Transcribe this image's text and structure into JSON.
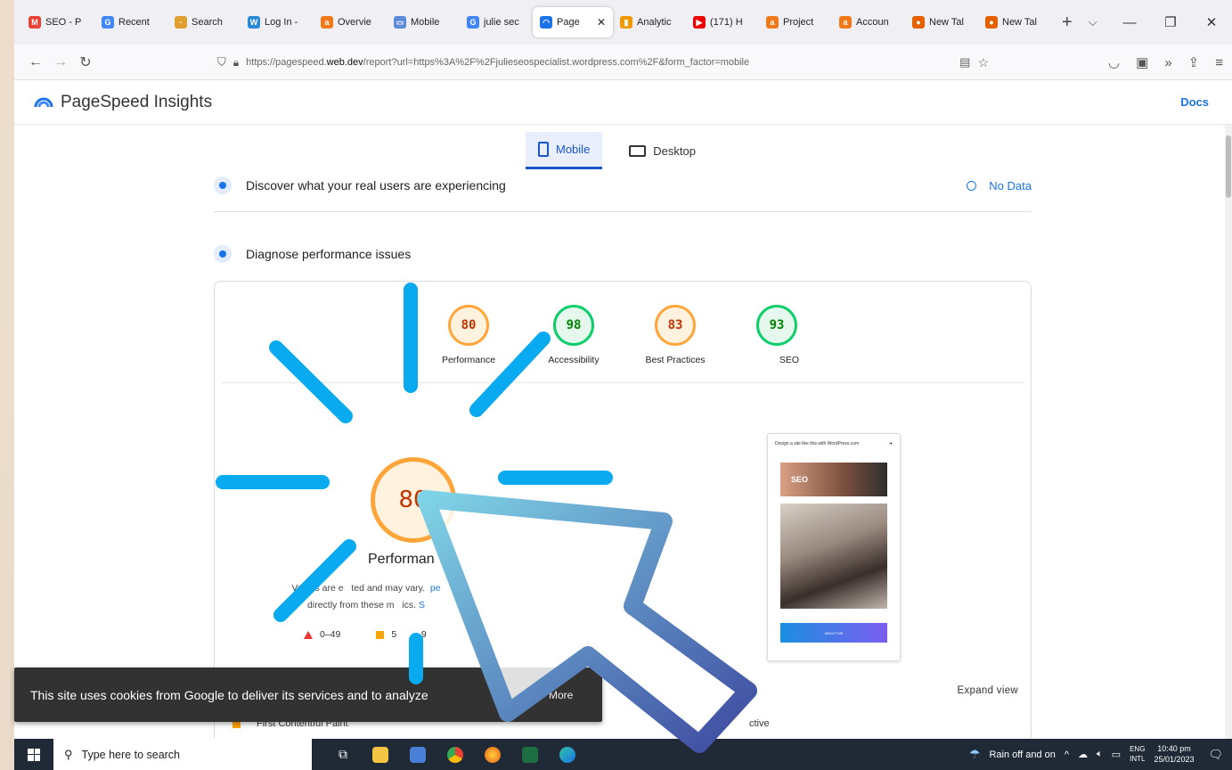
{
  "tabs": [
    {
      "label": "SEO - P",
      "color": "#ea4335",
      "glyph": "M"
    },
    {
      "label": "Recent",
      "color": "#4285f4",
      "glyph": "G"
    },
    {
      "label": "Search",
      "color": "#e0a030",
      "glyph": "·"
    },
    {
      "label": "Log In -",
      "color": "#2a8ad8",
      "glyph": "W"
    },
    {
      "label": "Overvie",
      "color": "#f07a1a",
      "glyph": "a"
    },
    {
      "label": "Mobile",
      "color": "#5a8ad8",
      "glyph": "▭"
    },
    {
      "label": "julie sec",
      "color": "#4285f4",
      "glyph": "G"
    },
    {
      "label": "Page",
      "color": "#1a73e8",
      "glyph": "◠",
      "active": true
    },
    {
      "label": "Analytic",
      "color": "#f29900",
      "glyph": "▮"
    },
    {
      "label": "(171) H",
      "color": "#e00",
      "glyph": "▶"
    },
    {
      "label": "Project",
      "color": "#f07a1a",
      "glyph": "a"
    },
    {
      "label": "Accoun",
      "color": "#f07a1a",
      "glyph": "a"
    },
    {
      "label": "New Tal",
      "color": "#e66000",
      "glyph": "●"
    },
    {
      "label": "New Tal",
      "color": "#e66000",
      "glyph": "●"
    }
  ],
  "browser": {
    "url_prefix": "https://pagespeed.",
    "url_host": "web.dev",
    "url_rest": "/report?url=https%3A%2F%2Fjulieseospecialist.wordpress.com%2F&form_factor=mobile"
  },
  "psi": {
    "title": "PageSpeed Insights",
    "docs": "Docs",
    "tab_mobile": "Mobile",
    "tab_desktop": "Desktop",
    "discover": "Discover what your real users are experiencing",
    "no_data": "No Data",
    "diagnose": "Diagnose performance issues"
  },
  "scores": [
    {
      "value": "80",
      "label": "Performance",
      "status": "orange"
    },
    {
      "value": "98",
      "label": "Accessibility",
      "status": "green"
    },
    {
      "value": "83",
      "label": "Best Practices",
      "status": "orange"
    },
    {
      "value": "93",
      "label": "SEO",
      "status": "green"
    }
  ],
  "main_score": {
    "value": "80",
    "label": "Performan"
  },
  "note": {
    "line1_a": "Values are e",
    "line1_b": "ted and may vary.",
    "line1_link": "pe",
    "line2": "directly from these m",
    "line2_b": "ics.",
    "line2_link": "S"
  },
  "legend": {
    "fail": "0–49",
    "average": "5",
    "average_tail": "9"
  },
  "phone": {
    "banner": "Design a site like this with WordPress.com",
    "hero_text": "SEO",
    "button": "ABOUT ME"
  },
  "expand_view": "Expand view",
  "metrics": {
    "first": "First Contentful Paint",
    "right": "ctive"
  },
  "cookie": {
    "text": "This site uses cookies from Google to deliver its services and to analyze",
    "more": "More"
  },
  "taskbar": {
    "search_placeholder": "Type here to search",
    "weather": "Rain off and on",
    "lang_1": "ENG",
    "lang_2": "INTL",
    "time": "10:40 pm",
    "date": "25/01/2023"
  }
}
